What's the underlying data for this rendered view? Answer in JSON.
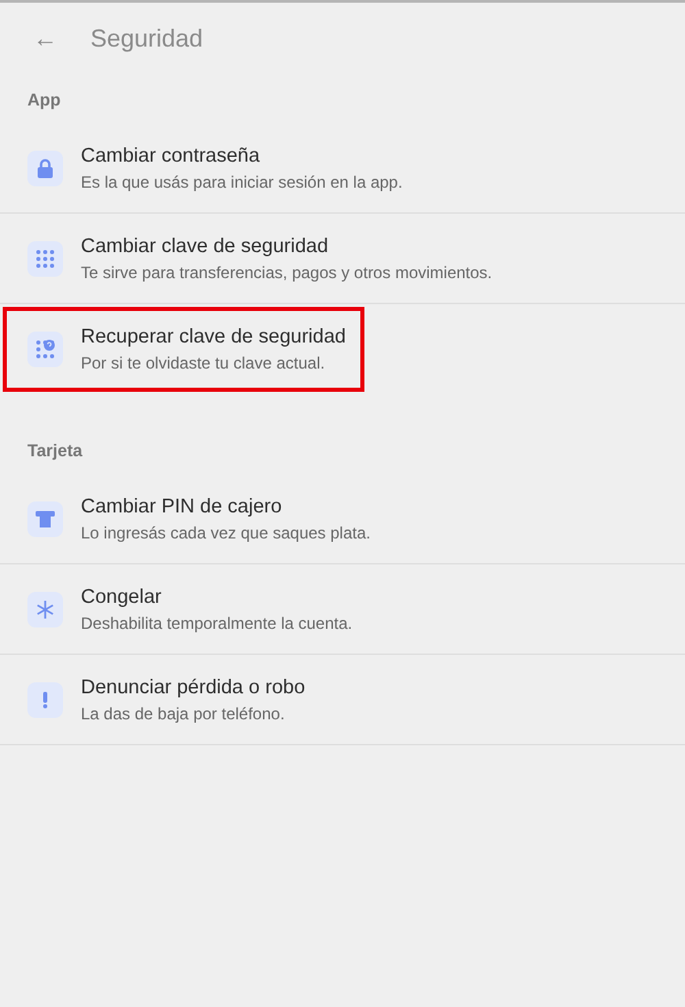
{
  "header": {
    "back": "←",
    "title": "Seguridad"
  },
  "sections": [
    {
      "title": "App",
      "items": [
        {
          "title": "Cambiar contraseña",
          "subtitle": "Es la que usás para iniciar sesión en la app.",
          "highlighted": false
        },
        {
          "title": "Cambiar clave de seguridad",
          "subtitle": "Te sirve para transferencias, pagos y otros movimientos.",
          "highlighted": false
        },
        {
          "title": "Recuperar clave de seguridad",
          "subtitle": "Por si te olvidaste tu clave actual.",
          "highlighted": true
        }
      ]
    },
    {
      "title": "Tarjeta",
      "items": [
        {
          "title": "Cambiar PIN de cajero",
          "subtitle": "Lo ingresás cada vez que saques plata.",
          "highlighted": false
        },
        {
          "title": "Congelar",
          "subtitle": "Deshabilita temporalmente la cuenta.",
          "highlighted": false
        },
        {
          "title": "Denunciar pérdida o robo",
          "subtitle": "La das de baja por teléfono.",
          "highlighted": false
        }
      ]
    }
  ]
}
